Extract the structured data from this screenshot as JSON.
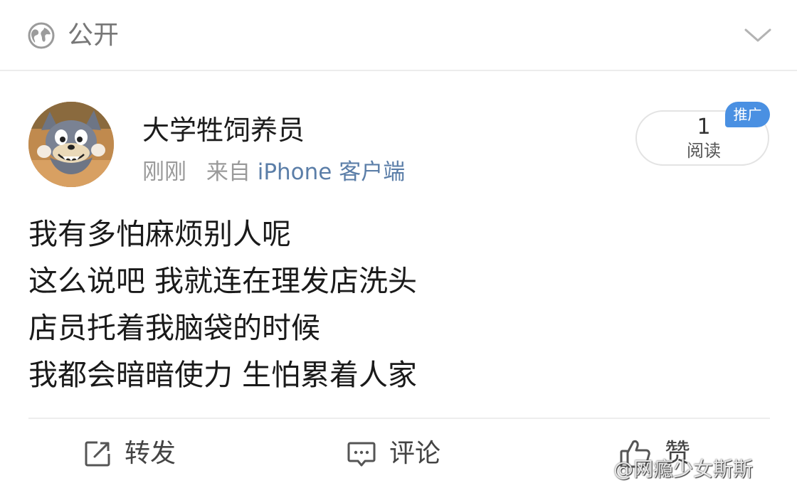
{
  "top_bar": {
    "visibility_label": "公开",
    "icons": {
      "visibility": "globe-icon",
      "expand": "chevron-down-icon"
    }
  },
  "post": {
    "username": "大学牲饲养员",
    "time": "刚刚",
    "source_prefix": "来自",
    "source_app": "iPhone 客户端",
    "read_count": "1",
    "read_label": "阅读",
    "promo_badge": "推广",
    "lines": [
      "我有多怕麻烦别人呢",
      "这么说吧 我就连在理发店洗头",
      "店员托着我脑袋的时候",
      "我都会暗暗使力 生怕累着人家"
    ]
  },
  "actions": {
    "repost_label": "转发",
    "comment_label": "评论",
    "like_label": "赞"
  },
  "watermark": "@网瘾少女斯斯",
  "colors": {
    "link_blue": "#5b7ea8",
    "badge_blue": "#4a90e2",
    "muted_text": "#9a9a9a"
  }
}
